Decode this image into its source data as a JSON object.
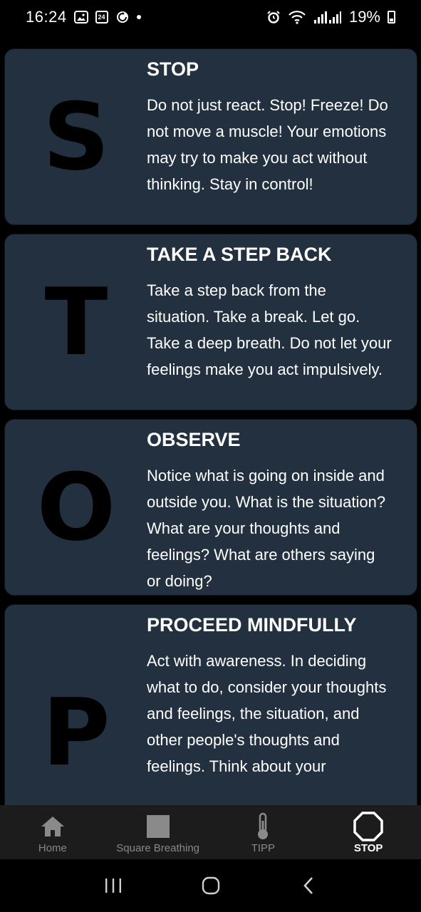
{
  "status_bar": {
    "time": "16:24",
    "calendar_badge": "24",
    "battery": "19%"
  },
  "cards": [
    {
      "letter": "S",
      "title": "STOP",
      "body": "Do not just react. Stop! Freeze! Do not move a muscle! Your emotions may try to make you act without thinking. Stay in control!"
    },
    {
      "letter": "T",
      "title": "TAKE A STEP BACK",
      "body": "Take a step back from the situation. Take a break. Let go. Take a deep breath. Do not let your feelings make you act impulsively."
    },
    {
      "letter": "O",
      "title": "OBSERVE",
      "body": "Notice what is going on inside and outside you. What is the situation? What are your thoughts and feelings? What are others saying or doing?"
    },
    {
      "letter": "P",
      "title": "PROCEED MINDFULLY",
      "body": "Act with awareness. In deciding what to do, consider your thoughts and feelings, the situation, and other people's thoughts and feelings. Think about your"
    }
  ],
  "bottom_nav": {
    "items": [
      {
        "label": "Home",
        "icon": "home-icon",
        "active": false
      },
      {
        "label": "Square Breathing",
        "icon": "square-icon",
        "active": false
      },
      {
        "label": "TIPP",
        "icon": "thermometer-icon",
        "active": false
      },
      {
        "label": "STOP",
        "icon": "octagon-icon",
        "active": true
      }
    ],
    "active_color": "#ffffff",
    "inactive_color": "#888888"
  },
  "colors": {
    "card_background": "#22303f",
    "letter": "#000000",
    "nav_background": "#1c1c1c"
  }
}
